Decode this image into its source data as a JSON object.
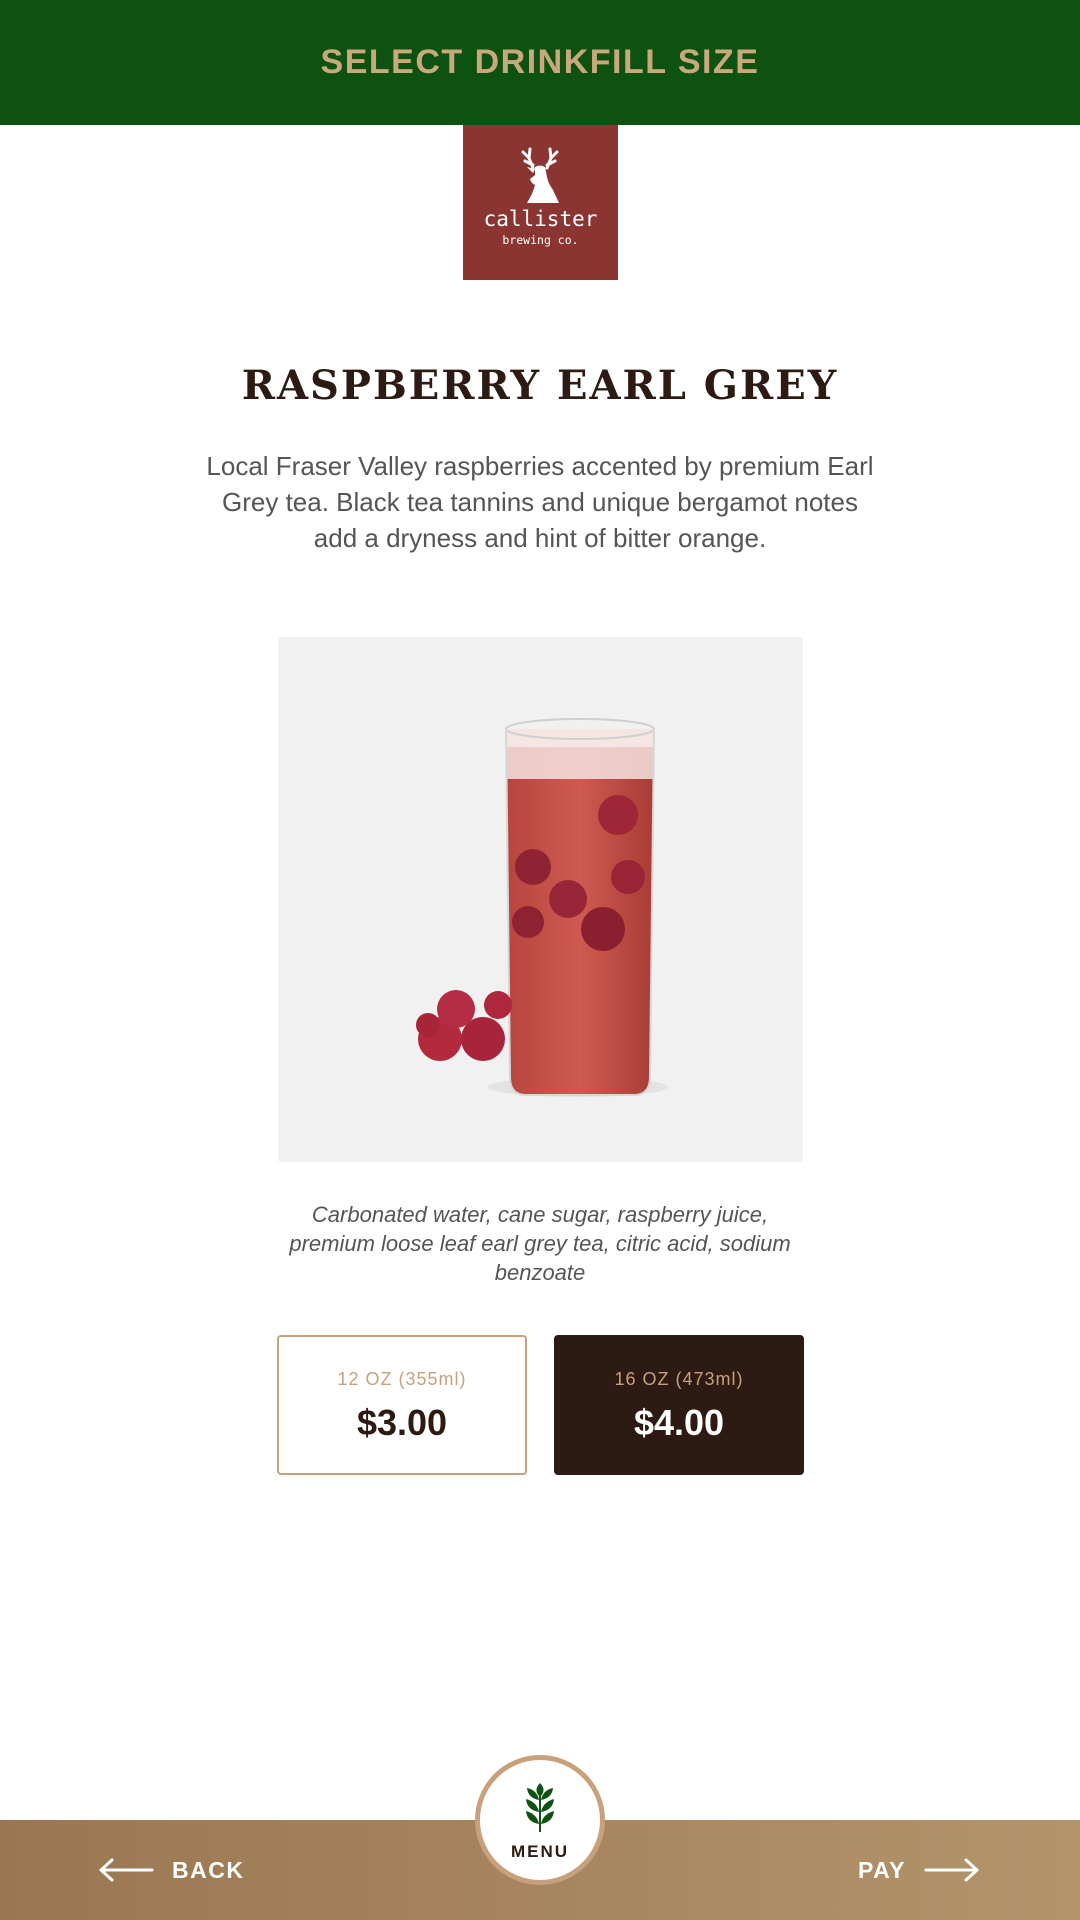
{
  "header": {
    "title": "SELECT DRINKFILL SIZE"
  },
  "logo": {
    "name": "callister",
    "tagline": "brewing co."
  },
  "product": {
    "name": "RASPBERRY EARL GREY",
    "description": "Local Fraser Valley raspberries accented by premium Earl Grey tea. Black tea tannins and unique bergamot notes add a dryness and hint of bitter orange.",
    "ingredients": "Carbonated water, cane sugar, raspberry juice, premium loose leaf earl grey tea, citric acid, sodium benzoate"
  },
  "sizes": [
    {
      "label": "12 OZ (355ml)",
      "price": "$3.00",
      "selected": false
    },
    {
      "label": "16 OZ (473ml)",
      "price": "$4.00",
      "selected": true
    }
  ],
  "footer": {
    "back_label": "BACK",
    "menu_label": "MENU",
    "pay_label": "PAY"
  },
  "icons": {
    "back": "arrow-left-icon",
    "pay": "arrow-right-icon",
    "menu": "wheat-leaf-icon",
    "logo": "deer-head-icon"
  },
  "colors": {
    "header_bg": "#0d5211",
    "accent_tan": "#c9a07c",
    "dark_brown": "#2d1a12",
    "logo_red": "#8a3532",
    "footer_gradient_start": "#9a7752",
    "footer_gradient_end": "#b2946b"
  }
}
